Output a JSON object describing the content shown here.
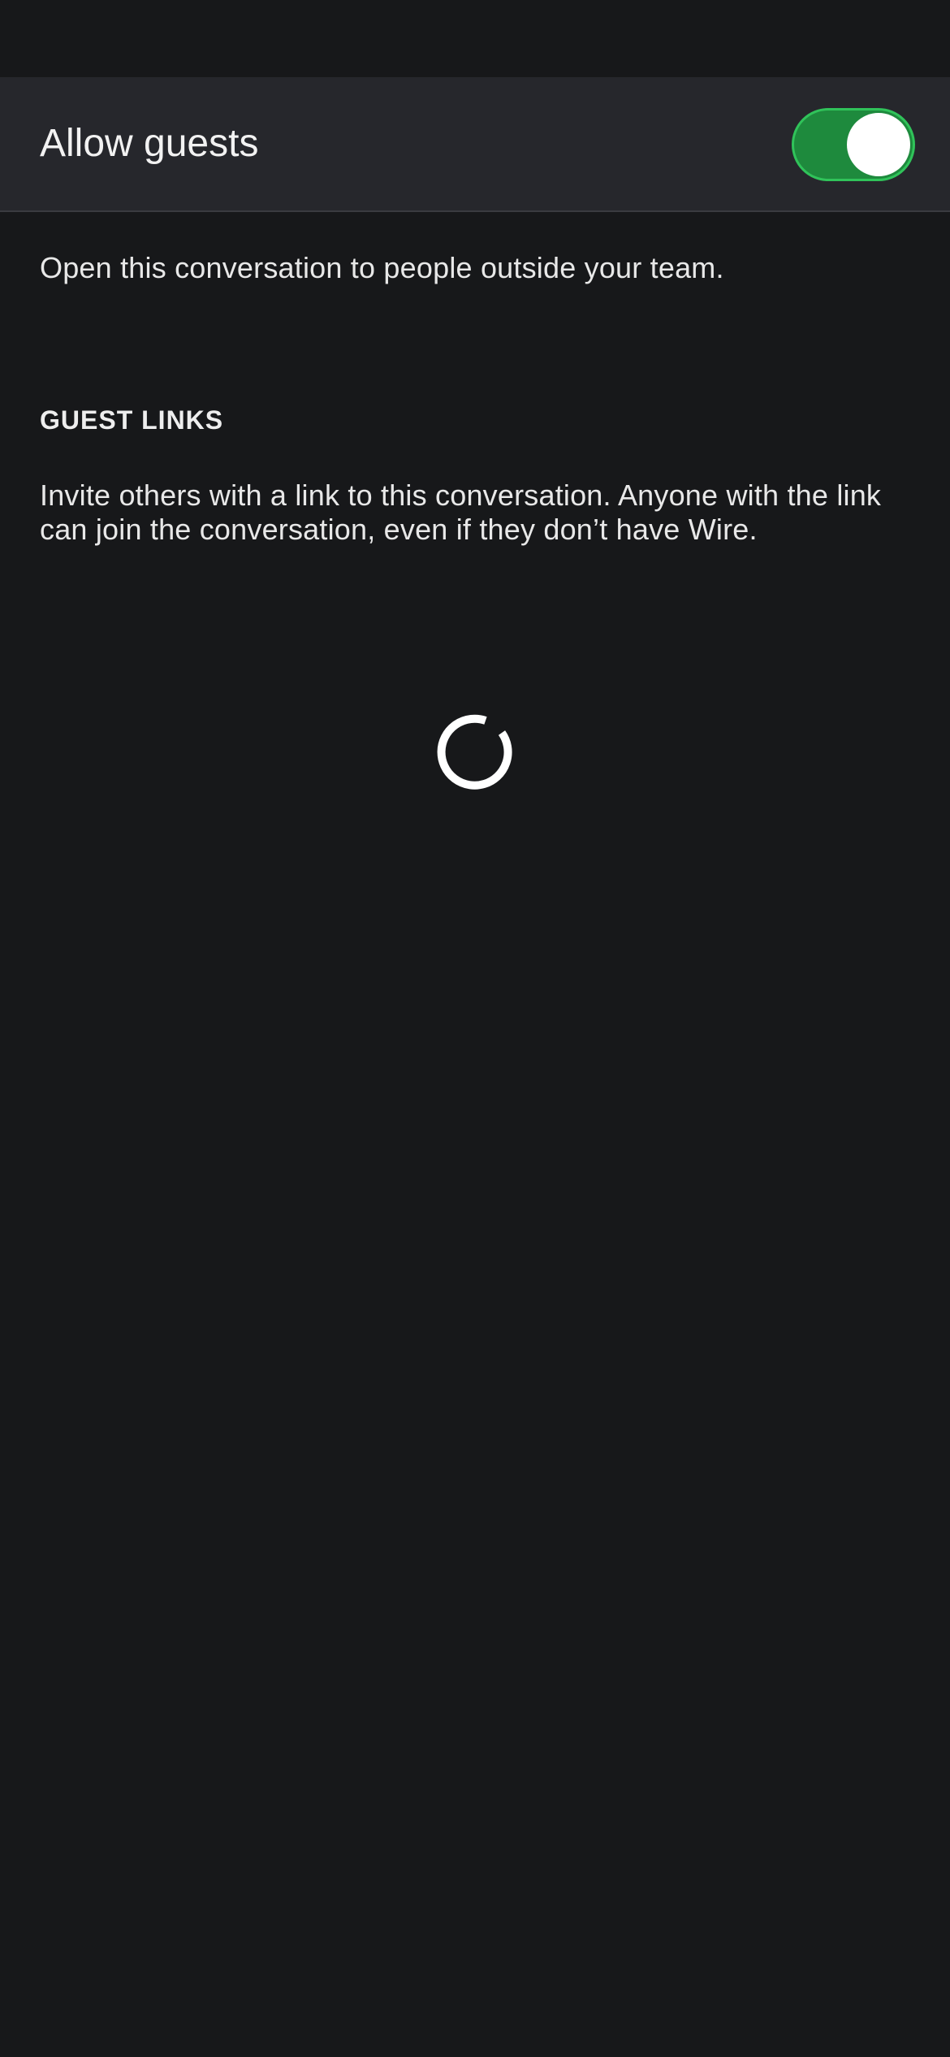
{
  "guests_setting": {
    "label": "Allow guests",
    "toggle_state": "on",
    "toggle_color": "#1e8a3d",
    "description": "Open this conversation to people outside your team."
  },
  "guest_links": {
    "header": "GUEST LINKS",
    "description": "Invite others with a link to this conversation. Anyone with the link can join the conversation, even if they don’t have Wire.",
    "status_icon": "loading-spinner-icon"
  },
  "colors": {
    "background": "#17181a",
    "row_background": "#26272c",
    "text": "#ffffff"
  }
}
